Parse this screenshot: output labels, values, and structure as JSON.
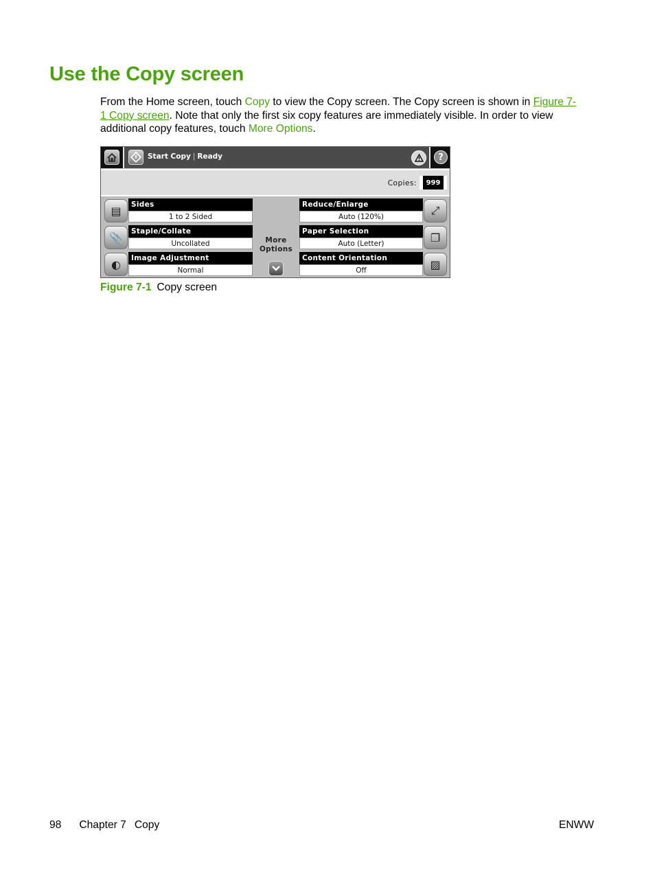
{
  "page": {
    "title": "Use the Copy screen",
    "paragraph": {
      "t1": "From the Home screen, touch ",
      "link_copy": "Copy",
      "t2": " to view the Copy screen. The Copy screen is shown in ",
      "link_figure": "Figure 7-1 Copy screen",
      "t3": ". Note that only the first six copy features are immediately visible. In order to view additional copy features, touch ",
      "link_more": "More Options",
      "t4": "."
    },
    "accent_color": "#4aa40e"
  },
  "copy_screen": {
    "top_bar": {
      "home_icon": "home-icon",
      "start_icon": "start-icon",
      "status_action": "Start Copy",
      "status_state": "Ready",
      "warning_icon": "warning-icon",
      "help_icon": "help-icon",
      "help_glyph": "?"
    },
    "copies": {
      "label": "Copies:",
      "value": "999"
    },
    "left_features": [
      {
        "label": "Sides",
        "value": "1 to 2 Sided",
        "icon": "sides-icon"
      },
      {
        "label": "Staple/Collate",
        "value": "Uncollated",
        "icon": "staple-icon"
      },
      {
        "label": "Image Adjustment",
        "value": "Normal",
        "icon": "image-adjustment-icon"
      }
    ],
    "right_features": [
      {
        "label": "Reduce/Enlarge",
        "value": "Auto (120%)",
        "icon": "reduce-enlarge-icon"
      },
      {
        "label": "Paper Selection",
        "value": "Auto (Letter)",
        "icon": "paper-selection-icon"
      },
      {
        "label": "Content Orientation",
        "value": "Off",
        "icon": "content-orientation-icon"
      }
    ],
    "more_options": {
      "line1": "More",
      "line2": "Options",
      "icon": "chevron-down-icon"
    }
  },
  "caption": {
    "figure": "Figure 7-1",
    "text": "Copy screen"
  },
  "footer": {
    "page_number": "98",
    "chapter": "Chapter 7",
    "section": "Copy",
    "right": "ENWW"
  }
}
